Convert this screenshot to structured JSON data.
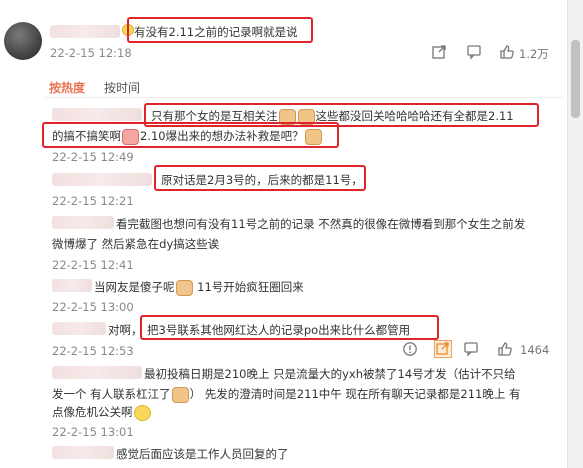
{
  "top_comment": {
    "text": "有没有2.11之前的记录啊就是说",
    "time": "22-2-15 12:18",
    "like_count": "1.2万"
  },
  "sort_tabs": [
    "按热度",
    "按时间"
  ],
  "replies": [
    {
      "line1": "只有那个女的是互相关注",
      "line1b": "这些都没回关哈哈哈哈还有全都是2.11",
      "line2a": "的搞不搞笑啊",
      "line2b": "2.10爆出来的想办法补救是吧？",
      "time": "22-2-15 12:49"
    },
    {
      "text": "原对话是2月3号的，后来的都是11号，",
      "time": "22-2-15 12:21"
    },
    {
      "line1": "看完截图也想问有没有11号之前的记录 不然真的很像在微博看到那个女生之前发",
      "line2": "微博爆了 然后紧急在dy搞这些诶",
      "time": "22-2-15 12:41"
    },
    {
      "prefix": "当网友是傻子呢",
      "suffix": "11号开始疯狂圈回来",
      "time": "22-2-15 13:00"
    },
    {
      "prefix": "对啊，",
      "text": "把3号联系其他网红达人的记录po出来比什么都管用",
      "time": "22-2-15 12:53",
      "like_count": "1464"
    },
    {
      "line1": "最初投稿日期是210晚上 只是流量大的yxh被禁了14号才发（估计不只给",
      "line2a": "发一个 有人联系杠江了",
      "line2b": "） 先发的澄清时间是211中午  现在所有聊天记录都是211晚上 有",
      "line3": "点像危机公关啊",
      "time": "22-2-15 13:01"
    },
    {
      "text": "感觉后面应该是工作人员回复的了"
    }
  ],
  "colors": {
    "highlight_box": "#e0242c",
    "active_tab": "#eb7350"
  },
  "icons": [
    "share-icon",
    "comment-icon",
    "like-icon",
    "warning-icon"
  ]
}
